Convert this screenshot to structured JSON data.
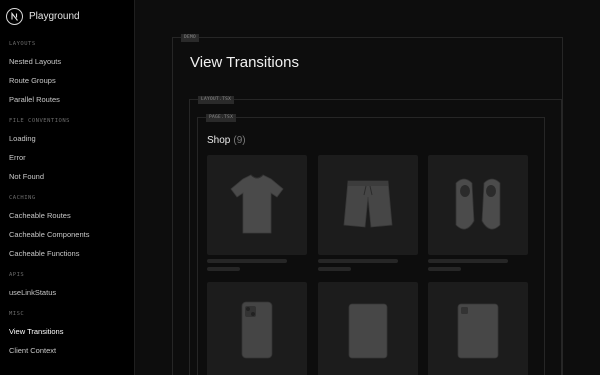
{
  "app": {
    "name": "Playground"
  },
  "sidebar": {
    "sections": [
      {
        "title": "LAYOUTS",
        "items": [
          "Nested Layouts",
          "Route Groups",
          "Parallel Routes"
        ]
      },
      {
        "title": "FILE CONVENTIONS",
        "items": [
          "Loading",
          "Error",
          "Not Found"
        ]
      },
      {
        "title": "CACHING",
        "items": [
          "Cacheable Routes",
          "Cacheable Components",
          "Cacheable Functions"
        ]
      },
      {
        "title": "APIS",
        "items": [
          "useLinkStatus"
        ]
      },
      {
        "title": "MISC",
        "items": [
          "View Transitions",
          "Client Context"
        ]
      }
    ],
    "active_item": "View Transitions"
  },
  "main": {
    "demo_label": "DEMO",
    "title": "View Transitions",
    "layout_label": "LAYOUT.TSX",
    "page_label": "PAGE.TSX",
    "shop": {
      "heading": "Shop",
      "count": "(9)"
    },
    "products": [
      {
        "icon": "tshirt-icon"
      },
      {
        "icon": "shorts-icon"
      },
      {
        "icon": "sneakers-icon"
      },
      {
        "icon": "phone-icon"
      },
      {
        "icon": "tablet-icon"
      },
      {
        "icon": "tablet-icon"
      }
    ]
  },
  "colors": {
    "background": "#0d0d0d",
    "sidebar": "#000000",
    "card": "#1c1c1c",
    "text": "#dddddd"
  }
}
